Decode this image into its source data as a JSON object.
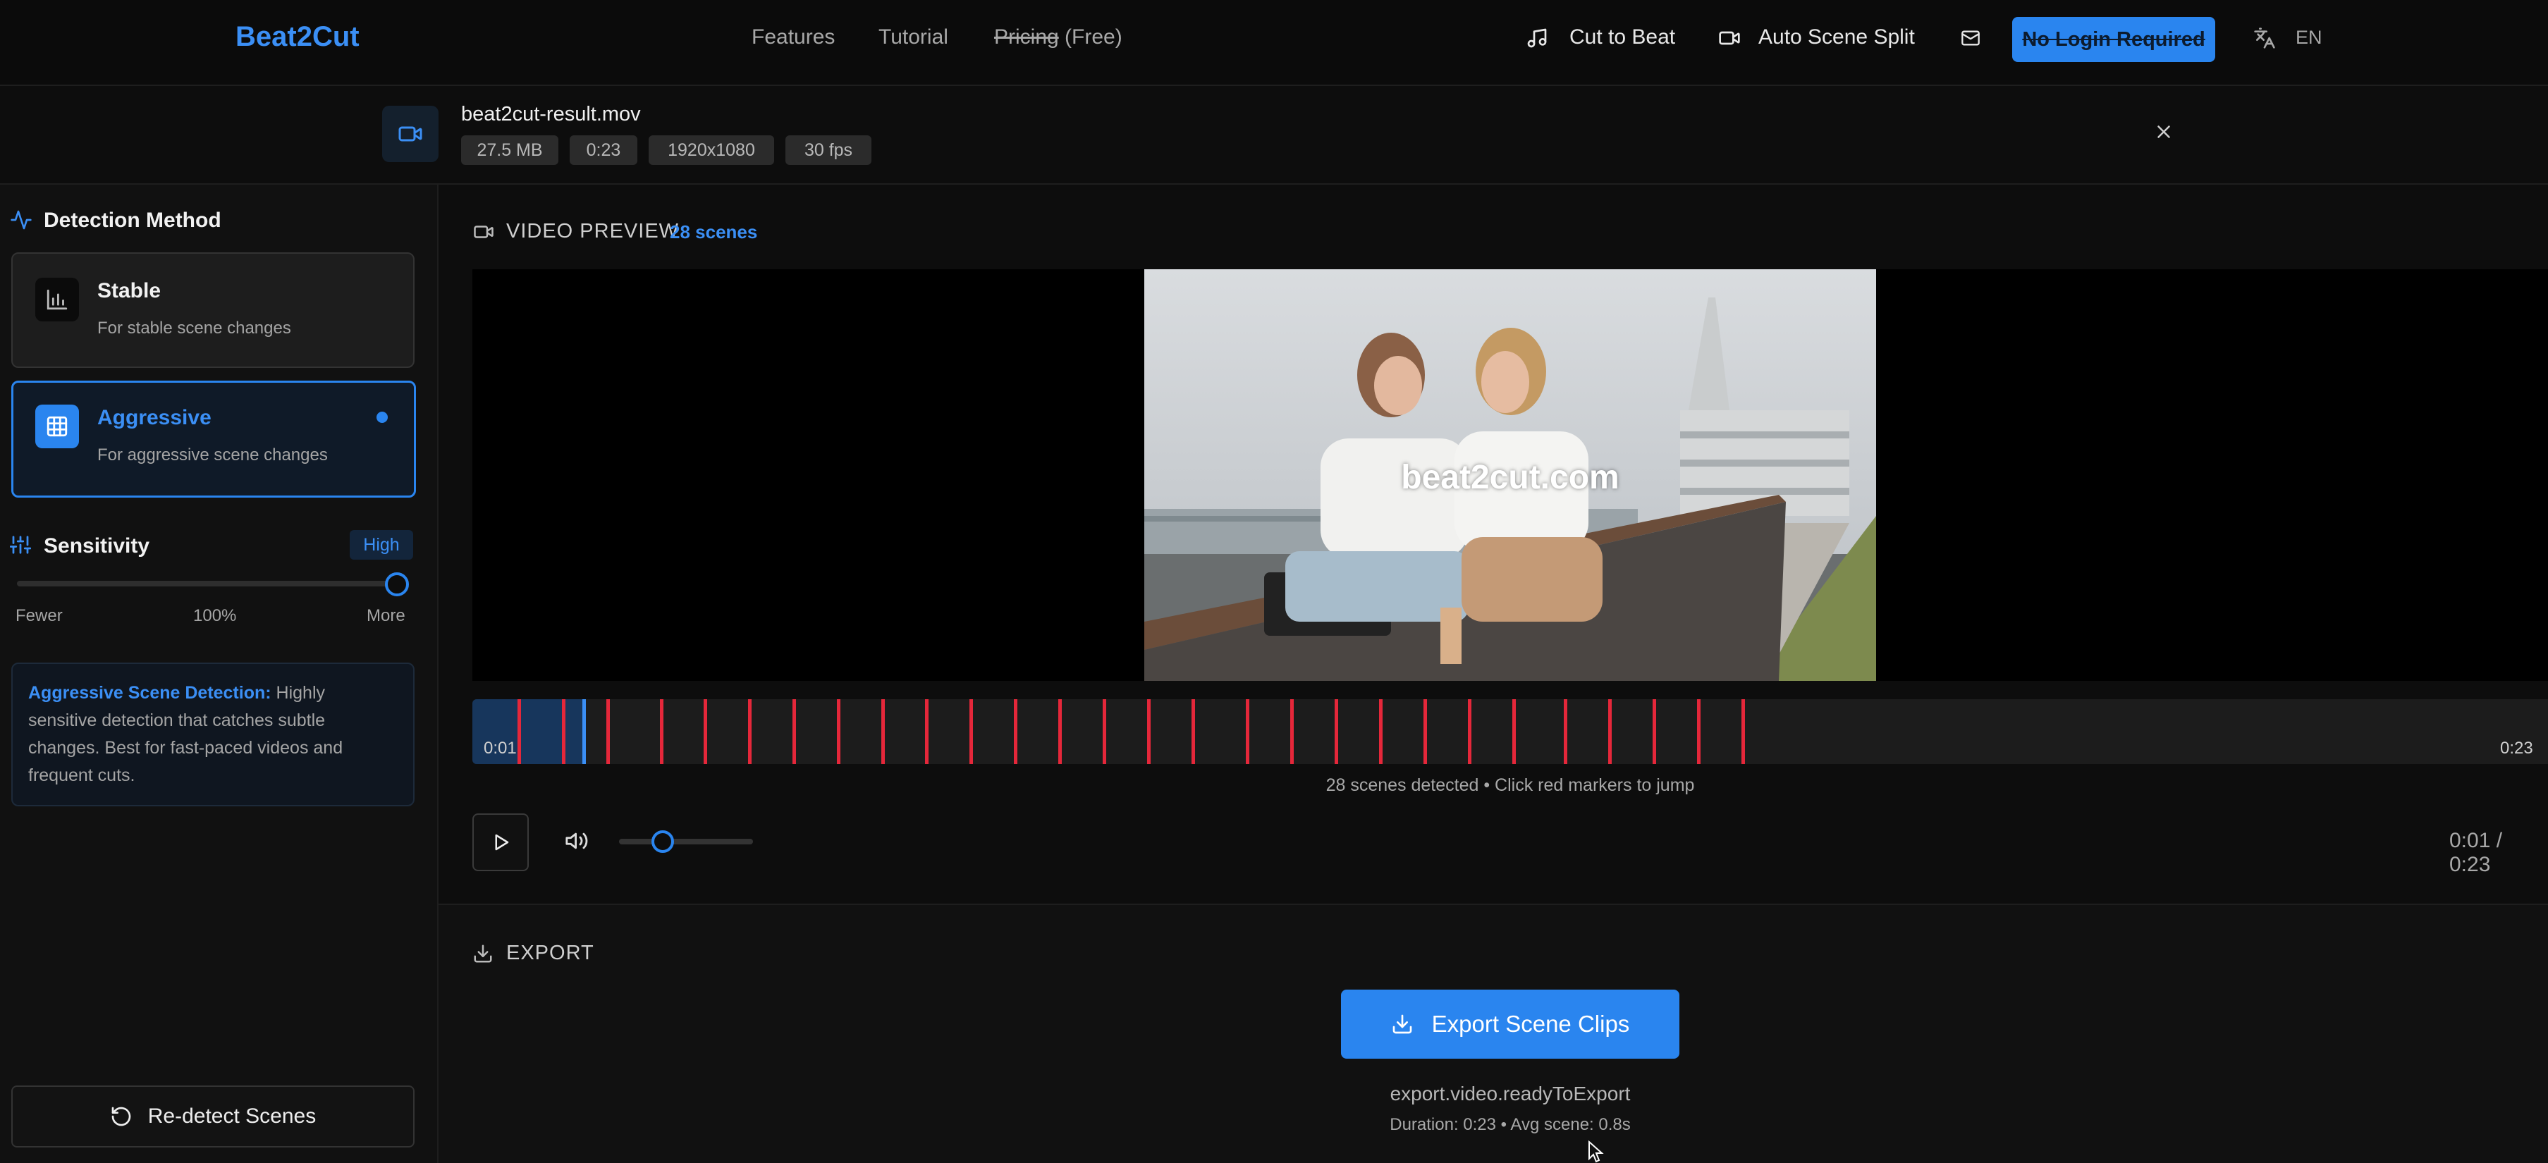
{
  "nav": {
    "brand": "Beat2Cut",
    "links": [
      "Features",
      "Tutorial"
    ],
    "pricing_strike": "Pricing",
    "pricing_free": "(Free)",
    "cut_to_beat": "Cut to Beat",
    "auto_scene_split": "Auto Scene Split",
    "login_btn": "No Login Required",
    "language": "EN"
  },
  "file": {
    "name": "beat2cut-result.mov",
    "size": "27.5 MB",
    "duration": "0:23",
    "resolution": "1920x1080",
    "fps": "30 fps"
  },
  "detection": {
    "title": "Detection Method",
    "stable_title": "Stable",
    "stable_desc": "For stable scene changes",
    "aggressive_title": "Aggressive",
    "aggressive_desc": "For aggressive scene changes",
    "selected": "Aggressive"
  },
  "sensitivity": {
    "title": "Sensitivity",
    "badge": "High",
    "min_label": "Fewer",
    "value_label": "100%",
    "max_label": "More",
    "value": 1.0
  },
  "info": {
    "heading": "Aggressive Scene Detection:",
    "body": " Highly sensitive detection that catches subtle changes. Best for fast-paced videos and frequent cuts."
  },
  "redetect_label": "Re-detect Scenes",
  "preview": {
    "label": "VIDEO PREVIEW",
    "scene_count": "28 scenes",
    "watermark": "beat2cut.com",
    "timeline_start": "0:01",
    "timeline_end": "0:23",
    "hint": "28 scenes detected • Click red markers to jump",
    "time_readout": "0:01 / 0:23",
    "played_fraction": 0.055,
    "volume_fraction": 0.33
  },
  "export": {
    "label": "EXPORT",
    "button": "Export Scene Clips",
    "status": "export.video.readyToExport",
    "meta": "Duration: 0:23 • Avg scene: 0.8s"
  },
  "colors": {
    "accent": "#2a85ef",
    "marker": "#e5273a",
    "background": "#0c0c0c"
  }
}
